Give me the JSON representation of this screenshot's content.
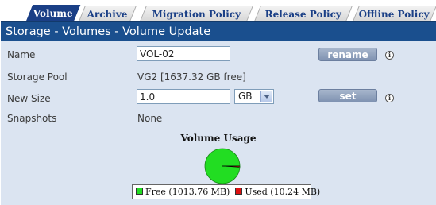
{
  "tabs": [
    {
      "label": "Volume",
      "active": true
    },
    {
      "label": "Archive",
      "active": false
    },
    {
      "label": "Migration Policy",
      "active": false
    },
    {
      "label": "Release Policy",
      "active": false
    },
    {
      "label": "Offline Policy",
      "active": false
    }
  ],
  "header": {
    "title": "Storage - Volumes - Volume Update"
  },
  "form": {
    "name": {
      "label": "Name",
      "value": "VOL-02",
      "button": "rename"
    },
    "pool": {
      "label": "Storage Pool",
      "value": "VG2 [1637.32 GB free]"
    },
    "size": {
      "label": "New Size",
      "value": "1.0",
      "unit": "GB",
      "button": "set"
    },
    "snapshots": {
      "label": "Snapshots",
      "value": "None"
    },
    "info_glyph": "i"
  },
  "chart_data": {
    "type": "pie",
    "title": "Volume Usage",
    "slices": [
      {
        "label": "Free",
        "value_mb": 1013.76,
        "legend": "Free (1013.76 MB)",
        "color": "#22dd22"
      },
      {
        "label": "Used",
        "value_mb": 10.24,
        "legend": "Used (10.24 MB)",
        "color": "#dd1111"
      }
    ]
  },
  "colors": {
    "header_bg": "#1a4f8e",
    "panel_bg": "#dbe4f1",
    "tab_active": "#1a3f86"
  }
}
